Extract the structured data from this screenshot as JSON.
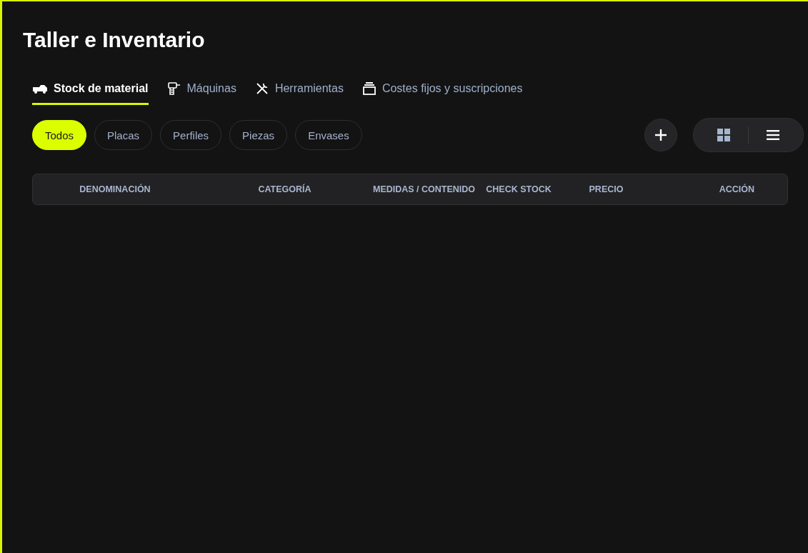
{
  "title": "Taller e Inventario",
  "tabs": [
    {
      "label": "Stock de material",
      "kind": "truck",
      "selected": true
    },
    {
      "label": "Máquinas",
      "kind": "drill",
      "selected": false
    },
    {
      "label": "Herramientas",
      "kind": "tools",
      "selected": false
    },
    {
      "label": "Costes fijos y suscripciones",
      "kind": "stack",
      "selected": false
    }
  ],
  "filters": [
    {
      "label": "Todos",
      "selected": true
    },
    {
      "label": "Placas",
      "selected": false
    },
    {
      "label": "Perfiles",
      "selected": false
    },
    {
      "label": "Piezas",
      "selected": false
    },
    {
      "label": "Envases",
      "selected": false
    }
  ],
  "view_toggle": [
    {
      "kind": "grid",
      "selected": false
    },
    {
      "kind": "list",
      "selected": true
    }
  ],
  "table": {
    "columns": [
      "DENOMINACIÓN",
      "CATEGORÍA",
      "MEDIDAS / CONTENIDO",
      "CHECK STOCK",
      "PRECIO",
      "ACCIÓN"
    ]
  }
}
